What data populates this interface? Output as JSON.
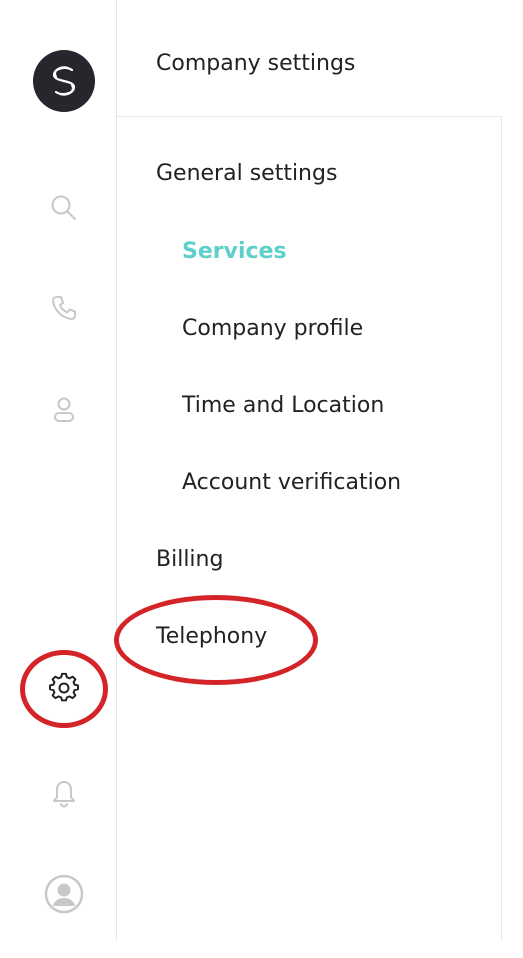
{
  "rail": {
    "items": [
      {
        "name": "search",
        "icon": "search-icon"
      },
      {
        "name": "calls",
        "icon": "phone-icon"
      },
      {
        "name": "contacts",
        "icon": "person-icon"
      },
      {
        "name": "settings",
        "icon": "gear-icon",
        "active": true
      },
      {
        "name": "notifications",
        "icon": "bell-icon"
      },
      {
        "name": "profile",
        "icon": "user-avatar-icon"
      }
    ]
  },
  "panel": {
    "title": "Company settings",
    "nav": [
      {
        "label": "General settings",
        "level": 1
      },
      {
        "label": "Services",
        "level": 2,
        "active": true
      },
      {
        "label": "Company profile",
        "level": 2
      },
      {
        "label": "Time and Location",
        "level": 2
      },
      {
        "label": "Account verification",
        "level": 2
      },
      {
        "label": "Billing",
        "level": 1
      },
      {
        "label": "Telephony",
        "level": 1
      }
    ]
  },
  "colors": {
    "active_item": "#5fcfc9",
    "annotation": "#d42428",
    "logo_bg": "#26262c",
    "icon_muted": "#c8c8c8",
    "icon_active": "#222222"
  }
}
